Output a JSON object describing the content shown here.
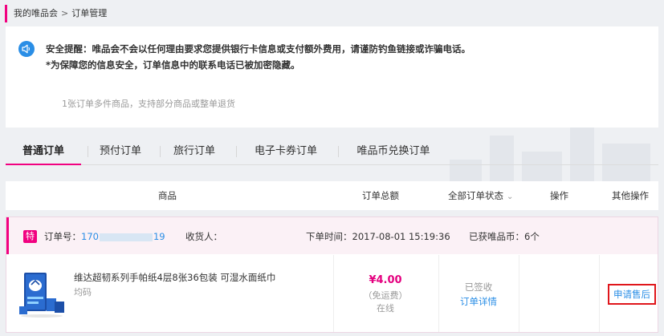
{
  "breadcrumb": {
    "home": "我的唯品会",
    "separator": ">",
    "current": "订单管理"
  },
  "notice": {
    "line1": "安全提醒：唯品会不会以任何理由要求您提供银行卡信息或支付额外费用，请谨防钓鱼链接或诈骗电话。",
    "line2": "*为保障您的信息安全，订单信息中的联系电话已被加密隐藏。",
    "line3": "1张订单多件商品，支持部分商品或整单退货",
    "icon": "speaker-icon"
  },
  "tabs": [
    {
      "label": "普通订单",
      "active": true
    },
    {
      "label": "预付订单",
      "active": false
    },
    {
      "label": "旅行订单",
      "active": false
    },
    {
      "label": "电子卡券订单",
      "active": false
    },
    {
      "label": "唯品币兑换订单",
      "active": false
    }
  ],
  "table_header": {
    "product": "商品",
    "total": "订单总额",
    "status_filter": "全部订单状态",
    "action": "操作",
    "other": "其他操作"
  },
  "order": {
    "badge": "特",
    "order_no_label": "订单号：",
    "order_no_start": "170",
    "order_no_end": "19",
    "receiver_label": "收货人：",
    "order_time": "下单时间：2017-08-01 15:19:36",
    "coins": "已获唯品币：6个",
    "product_name": "维达超韧系列手帕纸4层8张36包装 可湿水面纸巾",
    "product_spec": "均码",
    "price": "¥4.00",
    "freight": "（免运费）",
    "payment": "在线",
    "status": "已签收",
    "detail_link": "订单详情",
    "after_sale": "申请售后"
  },
  "colors": {
    "accent": "#f10180",
    "link": "#2a8ee6",
    "price": "#e4007f",
    "highlight": "#e0161b"
  }
}
